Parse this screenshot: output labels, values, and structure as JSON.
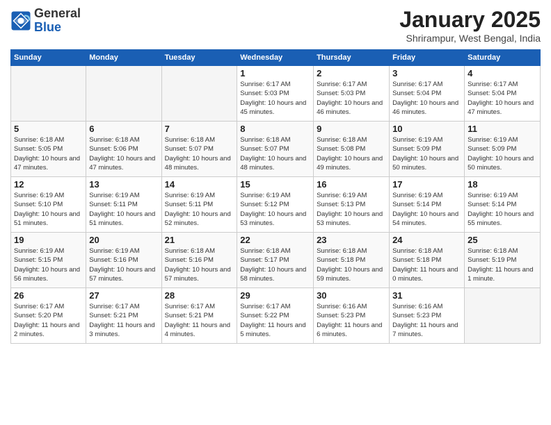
{
  "header": {
    "logo": {
      "general": "General",
      "blue": "Blue"
    },
    "title": "January 2025",
    "subtitle": "Shrirampur, West Bengal, India"
  },
  "days_of_week": [
    "Sunday",
    "Monday",
    "Tuesday",
    "Wednesday",
    "Thursday",
    "Friday",
    "Saturday"
  ],
  "weeks": [
    [
      {
        "day": "",
        "info": ""
      },
      {
        "day": "",
        "info": ""
      },
      {
        "day": "",
        "info": ""
      },
      {
        "day": "1",
        "info": "Sunrise: 6:17 AM\nSunset: 5:03 PM\nDaylight: 10 hours\nand 45 minutes."
      },
      {
        "day": "2",
        "info": "Sunrise: 6:17 AM\nSunset: 5:03 PM\nDaylight: 10 hours\nand 46 minutes."
      },
      {
        "day": "3",
        "info": "Sunrise: 6:17 AM\nSunset: 5:04 PM\nDaylight: 10 hours\nand 46 minutes."
      },
      {
        "day": "4",
        "info": "Sunrise: 6:17 AM\nSunset: 5:04 PM\nDaylight: 10 hours\nand 47 minutes."
      }
    ],
    [
      {
        "day": "5",
        "info": "Sunrise: 6:18 AM\nSunset: 5:05 PM\nDaylight: 10 hours\nand 47 minutes."
      },
      {
        "day": "6",
        "info": "Sunrise: 6:18 AM\nSunset: 5:06 PM\nDaylight: 10 hours\nand 47 minutes."
      },
      {
        "day": "7",
        "info": "Sunrise: 6:18 AM\nSunset: 5:07 PM\nDaylight: 10 hours\nand 48 minutes."
      },
      {
        "day": "8",
        "info": "Sunrise: 6:18 AM\nSunset: 5:07 PM\nDaylight: 10 hours\nand 48 minutes."
      },
      {
        "day": "9",
        "info": "Sunrise: 6:18 AM\nSunset: 5:08 PM\nDaylight: 10 hours\nand 49 minutes."
      },
      {
        "day": "10",
        "info": "Sunrise: 6:19 AM\nSunset: 5:09 PM\nDaylight: 10 hours\nand 50 minutes."
      },
      {
        "day": "11",
        "info": "Sunrise: 6:19 AM\nSunset: 5:09 PM\nDaylight: 10 hours\nand 50 minutes."
      }
    ],
    [
      {
        "day": "12",
        "info": "Sunrise: 6:19 AM\nSunset: 5:10 PM\nDaylight: 10 hours\nand 51 minutes."
      },
      {
        "day": "13",
        "info": "Sunrise: 6:19 AM\nSunset: 5:11 PM\nDaylight: 10 hours\nand 51 minutes."
      },
      {
        "day": "14",
        "info": "Sunrise: 6:19 AM\nSunset: 5:11 PM\nDaylight: 10 hours\nand 52 minutes."
      },
      {
        "day": "15",
        "info": "Sunrise: 6:19 AM\nSunset: 5:12 PM\nDaylight: 10 hours\nand 53 minutes."
      },
      {
        "day": "16",
        "info": "Sunrise: 6:19 AM\nSunset: 5:13 PM\nDaylight: 10 hours\nand 53 minutes."
      },
      {
        "day": "17",
        "info": "Sunrise: 6:19 AM\nSunset: 5:14 PM\nDaylight: 10 hours\nand 54 minutes."
      },
      {
        "day": "18",
        "info": "Sunrise: 6:19 AM\nSunset: 5:14 PM\nDaylight: 10 hours\nand 55 minutes."
      }
    ],
    [
      {
        "day": "19",
        "info": "Sunrise: 6:19 AM\nSunset: 5:15 PM\nDaylight: 10 hours\nand 56 minutes."
      },
      {
        "day": "20",
        "info": "Sunrise: 6:19 AM\nSunset: 5:16 PM\nDaylight: 10 hours\nand 57 minutes."
      },
      {
        "day": "21",
        "info": "Sunrise: 6:18 AM\nSunset: 5:16 PM\nDaylight: 10 hours\nand 57 minutes."
      },
      {
        "day": "22",
        "info": "Sunrise: 6:18 AM\nSunset: 5:17 PM\nDaylight: 10 hours\nand 58 minutes."
      },
      {
        "day": "23",
        "info": "Sunrise: 6:18 AM\nSunset: 5:18 PM\nDaylight: 10 hours\nand 59 minutes."
      },
      {
        "day": "24",
        "info": "Sunrise: 6:18 AM\nSunset: 5:18 PM\nDaylight: 11 hours\nand 0 minutes."
      },
      {
        "day": "25",
        "info": "Sunrise: 6:18 AM\nSunset: 5:19 PM\nDaylight: 11 hours\nand 1 minute."
      }
    ],
    [
      {
        "day": "26",
        "info": "Sunrise: 6:17 AM\nSunset: 5:20 PM\nDaylight: 11 hours\nand 2 minutes."
      },
      {
        "day": "27",
        "info": "Sunrise: 6:17 AM\nSunset: 5:21 PM\nDaylight: 11 hours\nand 3 minutes."
      },
      {
        "day": "28",
        "info": "Sunrise: 6:17 AM\nSunset: 5:21 PM\nDaylight: 11 hours\nand 4 minutes."
      },
      {
        "day": "29",
        "info": "Sunrise: 6:17 AM\nSunset: 5:22 PM\nDaylight: 11 hours\nand 5 minutes."
      },
      {
        "day": "30",
        "info": "Sunrise: 6:16 AM\nSunset: 5:23 PM\nDaylight: 11 hours\nand 6 minutes."
      },
      {
        "day": "31",
        "info": "Sunrise: 6:16 AM\nSunset: 5:23 PM\nDaylight: 11 hours\nand 7 minutes."
      },
      {
        "day": "",
        "info": ""
      }
    ]
  ]
}
